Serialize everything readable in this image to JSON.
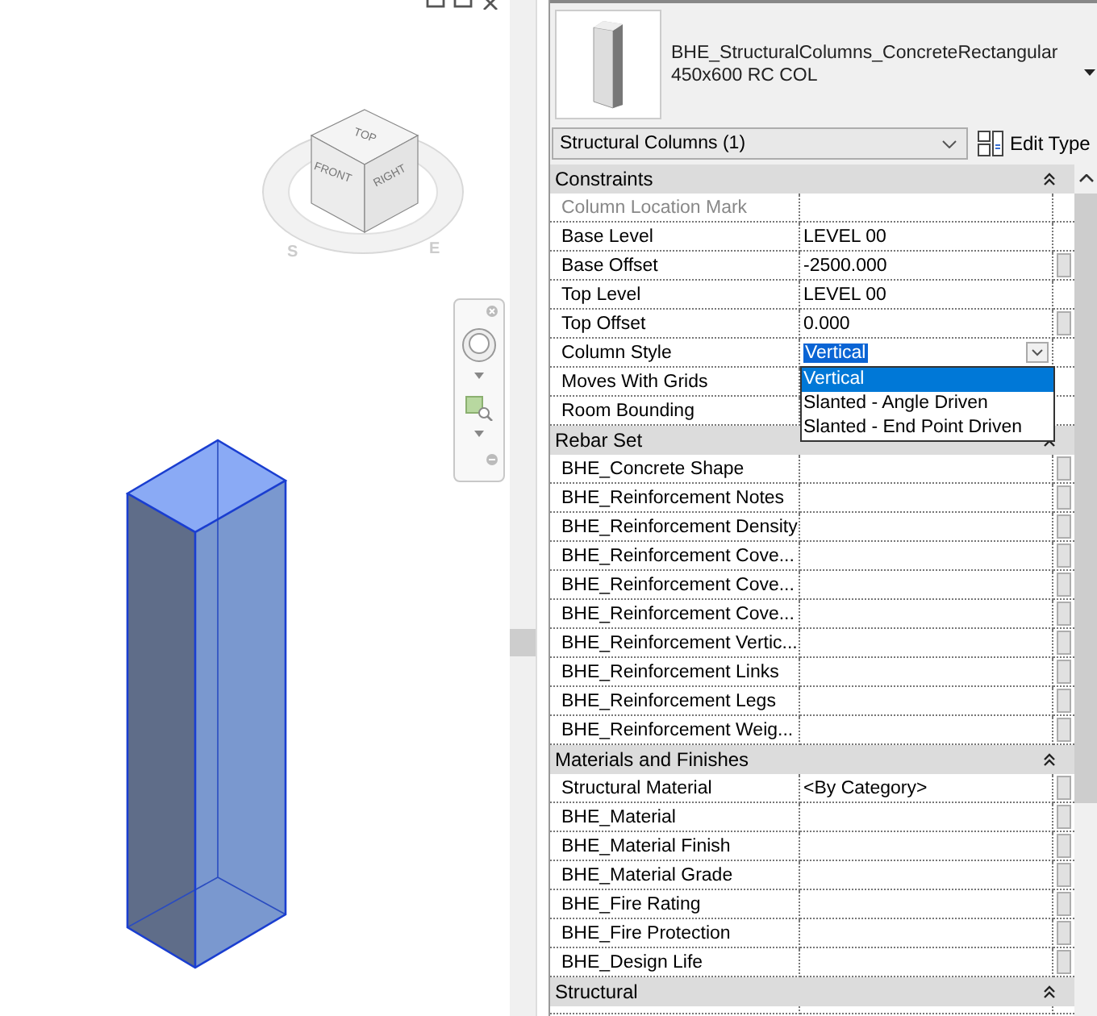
{
  "view_cube": {
    "faces": [
      "TOP",
      "FRONT",
      "RIGHT"
    ],
    "compass": [
      "S",
      "E"
    ]
  },
  "type_selector": {
    "family": "BHE_StructuralColumns_ConcreteRectangular",
    "type": "450x600 RC COL"
  },
  "filter": {
    "value": "Structural Columns (1)",
    "edit_type": "Edit Type"
  },
  "groups": [
    {
      "title": "Constraints",
      "rows": [
        {
          "name": "Column Location Mark",
          "value": "",
          "disabled": true,
          "button": false,
          "kind": "text"
        },
        {
          "name": "Base Level",
          "value": "LEVEL 00",
          "disabled": false,
          "button": false,
          "kind": "text"
        },
        {
          "name": "Base Offset",
          "value": "-2500.000",
          "disabled": false,
          "button": true,
          "kind": "text"
        },
        {
          "name": "Top Level",
          "value": "LEVEL 00",
          "disabled": false,
          "button": false,
          "kind": "text"
        },
        {
          "name": "Top Offset",
          "value": "0.000",
          "disabled": false,
          "button": true,
          "kind": "text"
        },
        {
          "name": "Column Style",
          "value": "Vertical",
          "disabled": false,
          "button": false,
          "kind": "dropdown",
          "options": [
            {
              "label": "Vertical",
              "selected": true
            },
            {
              "label": "Slanted - Angle Driven",
              "selected": false
            },
            {
              "label": "Slanted - End Point Driven",
              "selected": false
            }
          ]
        },
        {
          "name": "Moves With Grids",
          "value": "",
          "disabled": false,
          "button": false,
          "kind": "text"
        },
        {
          "name": "Room Bounding",
          "value": "",
          "disabled": false,
          "button": false,
          "kind": "text"
        }
      ]
    },
    {
      "title": "Rebar Set",
      "rows": [
        {
          "name": "BHE_Concrete Shape",
          "value": "",
          "disabled": false,
          "button": true,
          "kind": "text"
        },
        {
          "name": "BHE_Reinforcement Notes",
          "value": "",
          "disabled": false,
          "button": true,
          "kind": "text"
        },
        {
          "name": "BHE_Reinforcement Density",
          "value": "",
          "disabled": false,
          "button": true,
          "kind": "text"
        },
        {
          "name": "BHE_Reinforcement Cove...",
          "value": "",
          "disabled": false,
          "button": true,
          "kind": "text"
        },
        {
          "name": "BHE_Reinforcement Cove...",
          "value": "",
          "disabled": false,
          "button": true,
          "kind": "text"
        },
        {
          "name": "BHE_Reinforcement Cove...",
          "value": "",
          "disabled": false,
          "button": true,
          "kind": "text"
        },
        {
          "name": "BHE_Reinforcement Vertic...",
          "value": "",
          "disabled": false,
          "button": true,
          "kind": "text"
        },
        {
          "name": "BHE_Reinforcement Links",
          "value": "",
          "disabled": false,
          "button": true,
          "kind": "text"
        },
        {
          "name": "BHE_Reinforcement Legs",
          "value": "",
          "disabled": false,
          "button": true,
          "kind": "text"
        },
        {
          "name": "BHE_Reinforcement Weig...",
          "value": "",
          "disabled": false,
          "button": true,
          "kind": "text"
        }
      ]
    },
    {
      "title": "Materials and Finishes",
      "rows": [
        {
          "name": "Structural Material",
          "value": "<By Category>",
          "disabled": false,
          "button": true,
          "kind": "text"
        },
        {
          "name": "BHE_Material",
          "value": "",
          "disabled": false,
          "button": true,
          "kind": "text"
        },
        {
          "name": "BHE_Material Finish",
          "value": "",
          "disabled": false,
          "button": true,
          "kind": "text"
        },
        {
          "name": "BHE_Material Grade",
          "value": "",
          "disabled": false,
          "button": true,
          "kind": "text"
        },
        {
          "name": "BHE_Fire Rating",
          "value": "",
          "disabled": false,
          "button": true,
          "kind": "text"
        },
        {
          "name": "BHE_Fire Protection",
          "value": "",
          "disabled": false,
          "button": true,
          "kind": "text"
        },
        {
          "name": "BHE_Design Life",
          "value": "",
          "disabled": false,
          "button": true,
          "kind": "text"
        }
      ]
    },
    {
      "title": "Structural"
    }
  ]
}
